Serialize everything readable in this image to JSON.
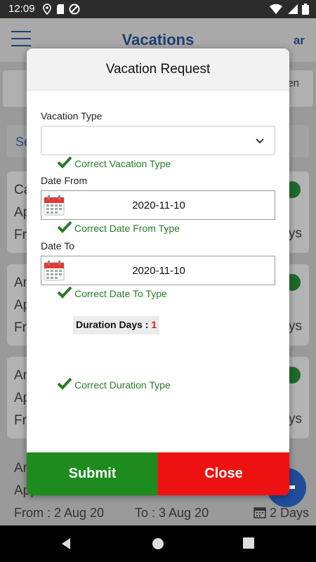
{
  "status_bar": {
    "time": "12:09",
    "icons_left": [
      "location-icon",
      "sd-card-icon",
      "do-not-disturb-icon"
    ],
    "icons_right": [
      "wifi-icon",
      "signal-icon",
      "battery-icon"
    ]
  },
  "app_bar": {
    "title": "Vacations",
    "lang_toggle": "ar"
  },
  "background": {
    "strip_text": "en",
    "search_text": "Se",
    "cards": [
      {
        "line1": "Ca",
        "line2": "Ap",
        "line3": "Fro",
        "days": "ays"
      },
      {
        "line1": "An",
        "line2": "Ap",
        "line3": "Fro",
        "days": "ays"
      },
      {
        "line1": "An",
        "line2": "Ap",
        "line3": "Fro",
        "days": "ays"
      }
    ],
    "last_card": {
      "line1": "An",
      "line2": "Approved",
      "from": "From :  2 Aug 20",
      "to": "To :  3 Aug 20",
      "days": "2 Days"
    }
  },
  "modal": {
    "title": "Vacation Request",
    "vacation_type": {
      "label": "Vacation Type",
      "value": "",
      "validation": "Correct Vacation Type"
    },
    "date_from": {
      "label": "Date From",
      "value": "2020-11-10",
      "validation": "Correct Date From Type"
    },
    "date_to": {
      "label": "Date To",
      "value": "2020-11-10",
      "validation": "Correct Date To Type"
    },
    "duration": {
      "label": "Duration Days :",
      "value": "1",
      "validation": "Correct Duration Type"
    },
    "submit_label": "Submit",
    "close_label": "Close"
  },
  "colors": {
    "accent": "#1f3f73",
    "valid_green": "#2a7a2a",
    "submit_green": "#1d8b1d",
    "close_red": "#ee1111",
    "duration_red": "#d32222"
  }
}
